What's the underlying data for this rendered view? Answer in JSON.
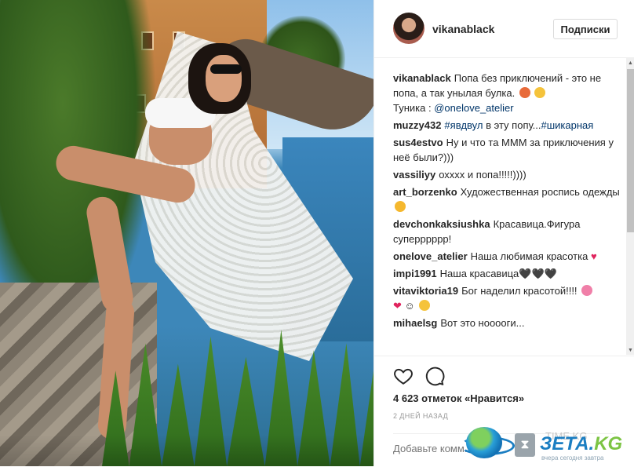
{
  "post": {
    "username": "vikanablack",
    "follow_label": "Подписки"
  },
  "comments": [
    {
      "user": "vikanablack",
      "text": "Попа без приключений - это не попа, а так унылая булка.",
      "text2": "Туника :",
      "mention": "@onelove_atelier"
    },
    {
      "user": "muzzy432",
      "tag1": "#явдвул",
      "text": "в эту попу...",
      "tag2": "#шикарная"
    },
    {
      "user": "sus4estvo",
      "text": "Ну и что та МММ за приключения у неё были?)))"
    },
    {
      "user": "vassiliyy",
      "text": "охххх и попа!!!!!))))"
    },
    {
      "user": "art_borzenko",
      "text": "Художественная роспись одежды"
    },
    {
      "user": "devchonkaksiushka",
      "text": "Красавица.Фигура суперррррр!"
    },
    {
      "user": "onelove_atelier",
      "text": "Наша любимая красотка"
    },
    {
      "user": "impi1991",
      "text": "Наша красавица🖤🖤🖤"
    },
    {
      "user": "vitaviktoria19",
      "text": "Бог наделил красотой!!!!"
    },
    {
      "user": "mihaelsg",
      "text": "Вот это нооооги..."
    }
  ],
  "actions": {
    "like_icon": "heart-icon",
    "comment_icon": "comment-icon",
    "likes": "4 623 отметок «Нравится»",
    "date": "2 дней назад",
    "add_comment_placeholder": "Добавьте комм..."
  },
  "watermark": {
    "brand_main": "ЗЕТА.",
    "brand_kg": "KG",
    "tagline": "вчера сегодня завтра",
    "faded": "TIME.KG"
  },
  "colors": {
    "link": "#003569",
    "text": "#262626",
    "muted": "#999999",
    "brand_blue": "#1b7ec2",
    "brand_green": "#7cc444"
  }
}
